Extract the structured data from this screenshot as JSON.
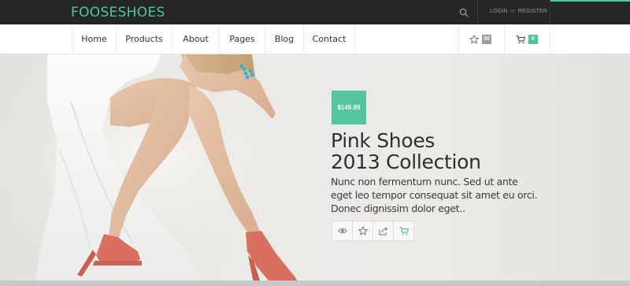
{
  "brand": {
    "logo": "FOOSESHOES",
    "accent": "#4ec59d"
  },
  "topbar": {
    "login": "LOGIN",
    "or": "or",
    "register": "REGISTER",
    "search_icon": "search-icon"
  },
  "nav": {
    "items": [
      {
        "label": "Home"
      },
      {
        "label": "Products"
      },
      {
        "label": "About"
      },
      {
        "label": "Pages"
      },
      {
        "label": "Blog"
      },
      {
        "label": "Contact"
      }
    ],
    "wishlist_count": "30",
    "cart_count": "0"
  },
  "hero": {
    "price": "$145.99",
    "title_line1": "Pink Shoes",
    "title_line2": "2013 Collection",
    "description": "Nunc non fermentum nunc. Sed ut ante eget leo tempor consequat sit amet eu orci. Donec dignissim dolor eget..",
    "actions": [
      "eye-icon",
      "star-icon",
      "share-icon",
      "add-to-cart-icon"
    ]
  }
}
